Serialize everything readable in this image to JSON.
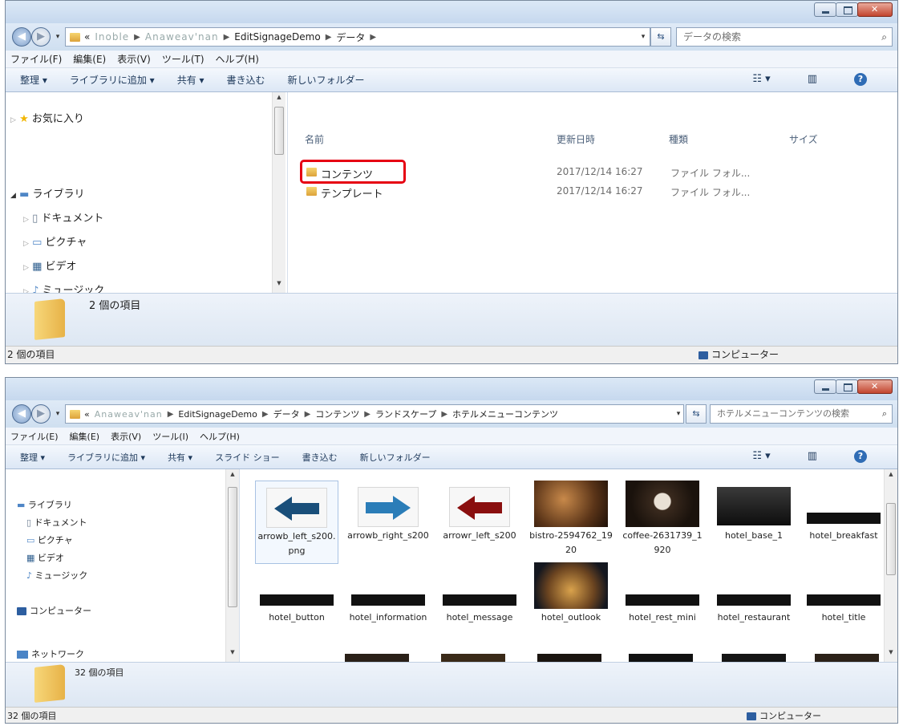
{
  "top_window": {
    "breadcrumb_lead": "«",
    "breadcrumb_blurred": [
      "Inoble",
      "Anaweav'nan"
    ],
    "breadcrumb": [
      "EditSignageDemo",
      "データ"
    ],
    "search_placeholder": "データの検索",
    "menu": [
      "ファイル(F)",
      "編集(E)",
      "表示(V)",
      "ツール(T)",
      "ヘルプ(H)"
    ],
    "toolbar": [
      "整理 ▾",
      "ライブラリに追加 ▾",
      "共有 ▾",
      "書き込む",
      "新しいフォルダー"
    ],
    "nav": {
      "favorites": "お気に入り",
      "libraries": "ライブラリ",
      "documents": "ドキュメント",
      "pictures": "ピクチャ",
      "videos": "ビデオ",
      "music": "ミュージック"
    },
    "columns": {
      "name": "名前",
      "date": "更新日時",
      "type": "種類",
      "size": "サイズ"
    },
    "files": [
      {
        "name": "コンテンツ",
        "date": "2017/12/14 16:27",
        "type": "ファイル フォル...",
        "highlighted": true
      },
      {
        "name": "テンプレート",
        "date": "2017/12/14 16:27",
        "type": "ファイル フォル...",
        "highlighted": false
      }
    ],
    "details_count": "2 個の項目",
    "status_count": "2 個の項目",
    "status_computer": "コンピューター",
    "highlight_color": "#e60012"
  },
  "bottom_window": {
    "breadcrumb_lead": "«",
    "breadcrumb_blurred": [
      "Anaweav'nan"
    ],
    "breadcrumb": [
      "EditSignageDemo",
      "データ",
      "コンテンツ",
      "ランドスケープ",
      "ホテルメニューコンテンツ"
    ],
    "search_placeholder": "ホテルメニューコンテンツの検索",
    "menu": [
      "ファイル(E)",
      "編集(E)",
      "表示(V)",
      "ツール(I)",
      "ヘルプ(H)"
    ],
    "toolbar": [
      "整理 ▾",
      "ライブラリに追加 ▾",
      "共有 ▾",
      "スライド ショー",
      "書き込む",
      "新しいフォルダー"
    ],
    "nav": {
      "libraries": "ライブラリ",
      "documents": "ドキュメント",
      "pictures": "ピクチャ",
      "videos": "ビデオ",
      "music": "ミュージック",
      "computer": "コンピューター",
      "network": "ネットワーク"
    },
    "items": [
      {
        "label": "arrowb_left_s200.png",
        "kind": "arrow-left-blue"
      },
      {
        "label": "arrowb_right_s200",
        "kind": "arrow-right-blue"
      },
      {
        "label": "arrowr_left_s200",
        "kind": "arrow-left-red"
      },
      {
        "label": "bistro-2594762_1920",
        "kind": "photo-bistro"
      },
      {
        "label": "coffee-2631739_1920",
        "kind": "photo-coffee"
      },
      {
        "label": "hotel_base_1",
        "kind": "black-panel"
      },
      {
        "label": "hotel_breakfast",
        "kind": "black-bar"
      },
      {
        "label": "hotel_button",
        "kind": "black-bar"
      },
      {
        "label": "hotel_information",
        "kind": "black-bar"
      },
      {
        "label": "hotel_message",
        "kind": "black-bar"
      },
      {
        "label": "hotel_outlook",
        "kind": "photo-hotel"
      },
      {
        "label": "hotel_rest_mini",
        "kind": "black-bar"
      },
      {
        "label": "hotel_restaurant",
        "kind": "black-bar"
      },
      {
        "label": "hotel_title",
        "kind": "black-bar"
      }
    ],
    "details_count": "32 個の項目",
    "status_count": "32 個の項目",
    "status_computer": "コンピューター"
  }
}
